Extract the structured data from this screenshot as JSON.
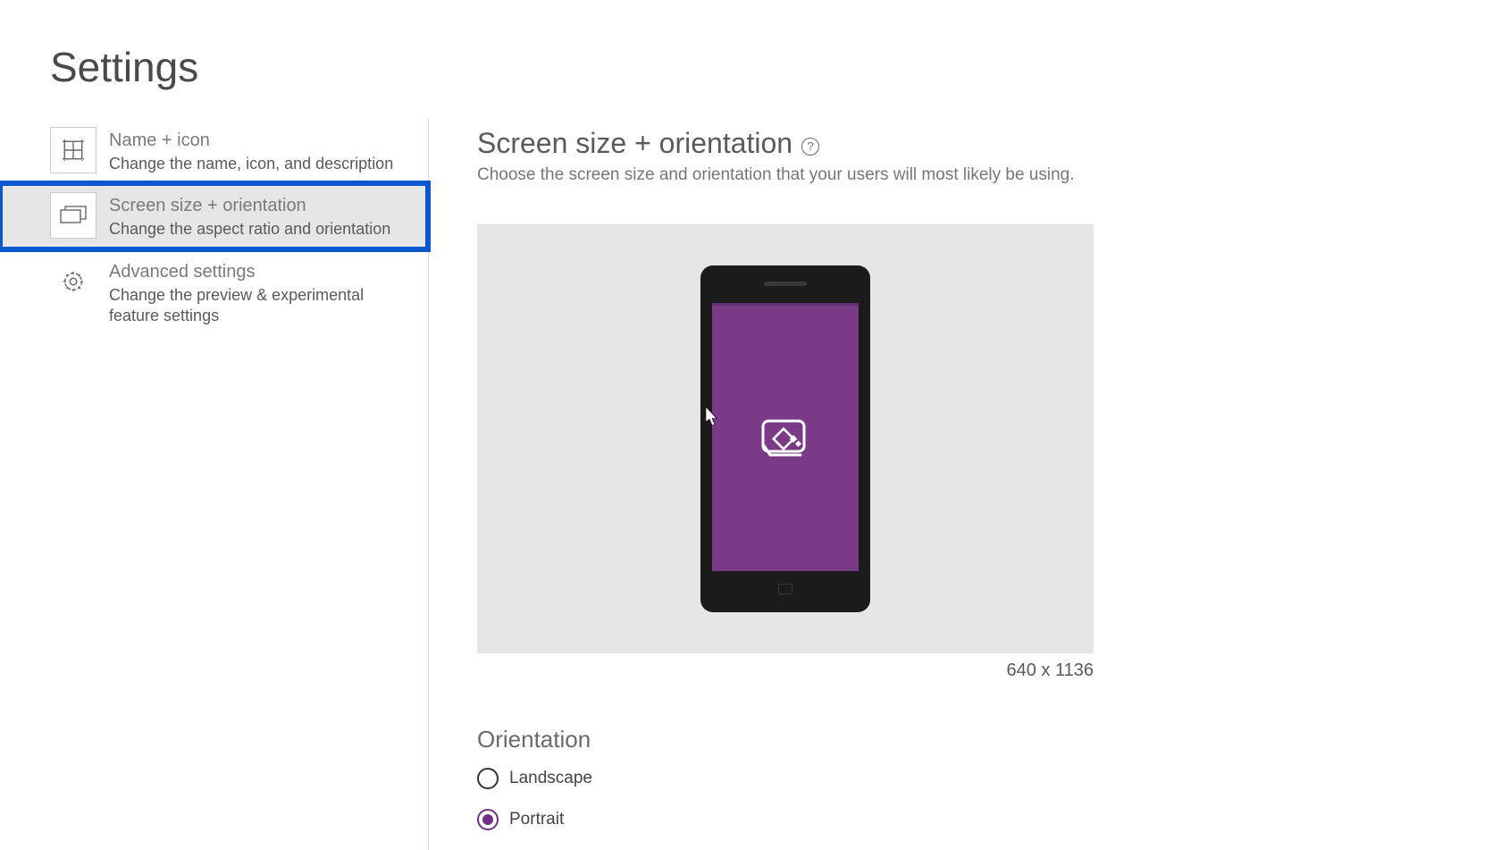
{
  "page_title": "Settings",
  "sidebar": {
    "items": [
      {
        "title": "Name + icon",
        "desc": "Change the name, icon, and description"
      },
      {
        "title": "Screen size + orientation",
        "desc": "Change the aspect ratio and orientation"
      },
      {
        "title": "Advanced settings",
        "desc": "Change the preview & experimental feature settings"
      }
    ]
  },
  "main": {
    "title": "Screen size + orientation",
    "help": "?",
    "subtitle": "Choose the screen size and orientation that your users will most likely be using.",
    "dimensions": "640 x 1136"
  },
  "orientation": {
    "heading": "Orientation",
    "options": {
      "landscape": "Landscape",
      "portrait": "Portrait"
    },
    "selected": "portrait"
  }
}
